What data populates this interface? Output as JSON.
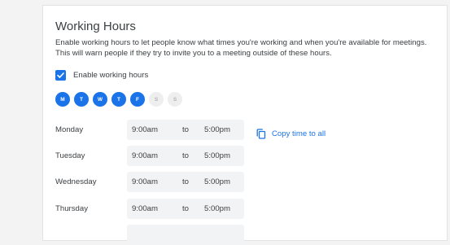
{
  "section": {
    "title": "Working Hours",
    "description": "Enable working hours to let people know what times you're working and when you're available for meetings. This will warn people if they try to invite you to a meeting outside of these hours."
  },
  "enable_checkbox": {
    "label": "Enable working hours",
    "checked": true
  },
  "days": [
    {
      "letter": "M",
      "selected": true
    },
    {
      "letter": "T",
      "selected": true
    },
    {
      "letter": "W",
      "selected": true
    },
    {
      "letter": "T",
      "selected": true
    },
    {
      "letter": "F",
      "selected": true
    },
    {
      "letter": "S",
      "selected": false
    },
    {
      "letter": "S",
      "selected": false
    }
  ],
  "schedule": [
    {
      "day": "Monday",
      "start": "9:00am",
      "separator": "to",
      "end": "5:00pm"
    },
    {
      "day": "Tuesday",
      "start": "9:00am",
      "separator": "to",
      "end": "5:00pm"
    },
    {
      "day": "Wednesday",
      "start": "9:00am",
      "separator": "to",
      "end": "5:00pm"
    },
    {
      "day": "Thursday",
      "start": "9:00am",
      "separator": "to",
      "end": "5:00pm"
    }
  ],
  "copy_action": {
    "label": "Copy time to all",
    "icon": "copy-icon"
  },
  "colors": {
    "accent": "#1a73e8",
    "field_bg": "#f1f3f4",
    "text": "#3c4043"
  }
}
